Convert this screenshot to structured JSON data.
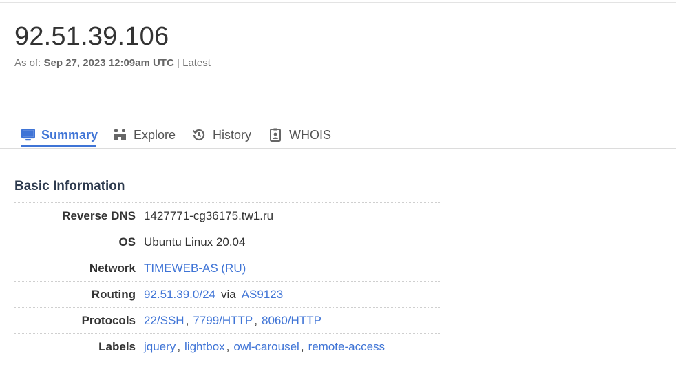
{
  "header": {
    "ip": "92.51.39.106",
    "as_of_label": "As of:",
    "as_of_date": "Sep 27, 2023 12:09am UTC",
    "as_of_separator": "|",
    "as_of_version": "Latest"
  },
  "tabs": [
    {
      "label": "Summary",
      "icon": "monitor-icon",
      "active": true
    },
    {
      "label": "Explore",
      "icon": "binoculars-icon",
      "active": false
    },
    {
      "label": "History",
      "icon": "history-icon",
      "active": false
    },
    {
      "label": "WHOIS",
      "icon": "id-badge-icon",
      "active": false
    }
  ],
  "basic_info": {
    "title": "Basic Information",
    "reverse_dns": {
      "key": "Reverse DNS",
      "value": "1427771-cg36175.tw1.ru"
    },
    "os": {
      "key": "OS",
      "value": "Ubuntu Linux 20.04"
    },
    "network": {
      "key": "Network",
      "value": "TIMEWEB-AS (RU)"
    },
    "routing": {
      "key": "Routing",
      "prefix": "92.51.39.0/24",
      "via": "via",
      "asn": "AS9123"
    },
    "protocols": {
      "key": "Protocols",
      "values": [
        "22/SSH",
        "7799/HTTP",
        "8060/HTTP"
      ]
    },
    "labels": {
      "key": "Labels",
      "values": [
        "jquery",
        "lightbox",
        "owl-carousel",
        "remote-access"
      ]
    }
  },
  "colors": {
    "accent": "#3f74d6",
    "heading": "#2d3a4e",
    "text": "#333333",
    "muted": "#777777"
  }
}
